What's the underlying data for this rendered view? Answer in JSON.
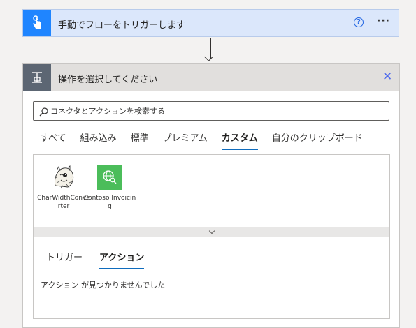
{
  "trigger": {
    "title": "手動でフローをトリガーします",
    "help_glyph": "?",
    "more_glyph": "···",
    "accent_color": "#1f85ff"
  },
  "action": {
    "title": "操作を選択してください",
    "close_glyph": "✕",
    "search_placeholder": "コネクタとアクションを検索する",
    "tabs": [
      {
        "label": "すべて"
      },
      {
        "label": "組み込み"
      },
      {
        "label": "標準"
      },
      {
        "label": "プレミアム"
      },
      {
        "label": "カスタム"
      },
      {
        "label": "自分のクリップボード"
      }
    ],
    "active_tab": "カスタム",
    "connectors": [
      {
        "label": "CharWidthConverter",
        "icon": "charwidthconverter-logo-icon"
      },
      {
        "label": "Contoso Invoicing",
        "icon": "contoso-invoicing-icon",
        "color": "#4bbd5a"
      }
    ],
    "sub_tabs": [
      {
        "label": "トリガー"
      },
      {
        "label": "アクション"
      }
    ],
    "active_sub_tab": "アクション",
    "empty_message": "アクション が見つかりませんでした"
  }
}
